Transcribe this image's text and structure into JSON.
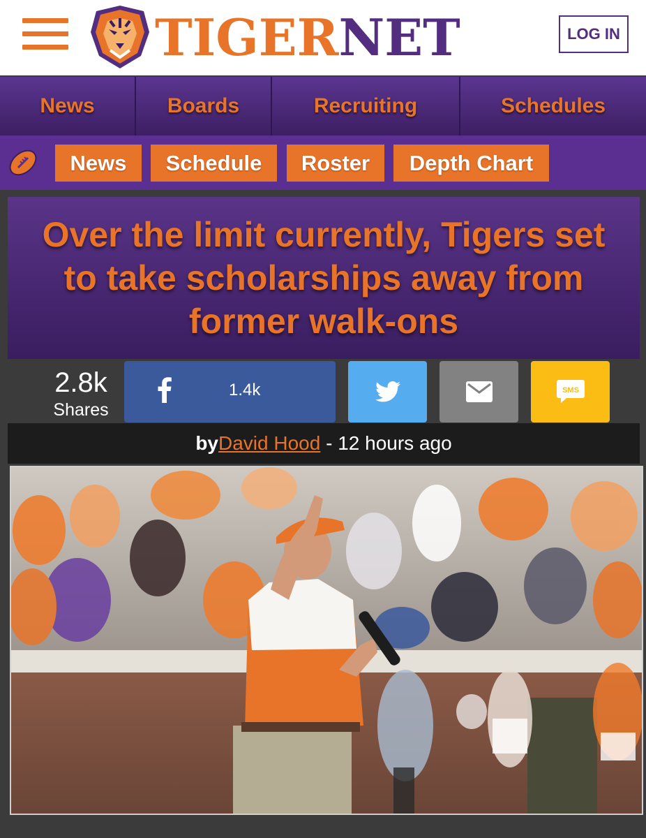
{
  "header": {
    "logo": {
      "brand_part1": "TIGER",
      "brand_part2": "NET"
    },
    "login_label": "LOG IN"
  },
  "main_nav": [
    {
      "label": "News"
    },
    {
      "label": "Boards"
    },
    {
      "label": "Recruiting"
    },
    {
      "label": "Schedules"
    }
  ],
  "sub_nav": {
    "icon": "football-icon",
    "items": [
      {
        "label": "News"
      },
      {
        "label": "Schedule"
      },
      {
        "label": "Roster"
      },
      {
        "label": "Depth Chart"
      }
    ]
  },
  "article": {
    "headline": "Over the limit currently, Tigers set to take scholarships away from former walk-ons",
    "byline": {
      "prefix": "by",
      "author": "David Hood",
      "separator": " - ",
      "time": "12 hours ago"
    }
  },
  "share": {
    "total": "2.8k",
    "total_label": "Shares",
    "facebook_count": "1.4k",
    "buttons": [
      "facebook-icon",
      "twitter-icon",
      "email-icon",
      "sms-icon"
    ],
    "sms_label": "SMS"
  },
  "colors": {
    "orange": "#e8742a",
    "purple": "#522d80",
    "facebook": "#3b5a9c",
    "twitter": "#55acee",
    "email": "#828282",
    "sms": "#fbbd14"
  }
}
